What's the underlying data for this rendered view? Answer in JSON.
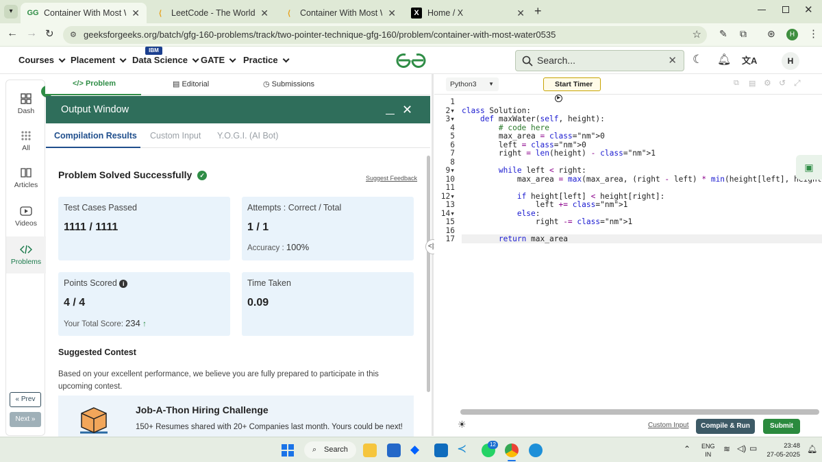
{
  "browser": {
    "tabs": [
      {
        "title": "Container With Most Water | Pr",
        "favicon": "GG",
        "active": true
      },
      {
        "title": "LeetCode - The World's Leading",
        "favicon": "leetcode-icon",
        "active": false
      },
      {
        "title": "Container With Most Water - Le",
        "favicon": "leetcode-icon",
        "active": false
      },
      {
        "title": "Home / X",
        "favicon": "X",
        "active": false
      }
    ],
    "url": "geeksforgeeks.org/batch/gfg-160-problems/track/two-pointer-technique-gfg-160/problem/container-with-most-water0535",
    "profile_initial": "H"
  },
  "header": {
    "nav": [
      {
        "label": "Courses"
      },
      {
        "label": "Placement"
      },
      {
        "label": "Data Science",
        "badge": "IBM"
      },
      {
        "label": "GATE"
      },
      {
        "label": "Practice"
      }
    ],
    "search_placeholder": "Search...",
    "avatar_initial": "H"
  },
  "left_rail": {
    "items": [
      {
        "label": "Dash",
        "icon": "dashboard-icon"
      },
      {
        "label": "All",
        "icon": "grid-icon"
      },
      {
        "label": "Articles",
        "icon": "book-icon"
      },
      {
        "label": "Videos",
        "icon": "video-icon"
      },
      {
        "label": "Problems",
        "icon": "code-icon",
        "active": true
      }
    ],
    "prev_label": "Prev",
    "next_label": "Next"
  },
  "problem_tabs": {
    "problem": "Problem",
    "editorial": "Editorial",
    "submissions": "Submissions"
  },
  "output": {
    "title": "Output Window",
    "tabs": {
      "compilation": "Compilation Results",
      "custom": "Custom Input",
      "yogi": "Y.O.G.I. (AI Bot)"
    },
    "status": "Problem Solved Successfully",
    "feedback": "Suggest Feedback",
    "cards": {
      "test_label": "Test Cases Passed",
      "test_value": "1111 / 1111",
      "attempts_label": "Attempts : Correct / Total",
      "attempts_value": "1 / 1",
      "accuracy_label": "Accuracy :",
      "accuracy_value": "100%",
      "points_label": "Points Scored",
      "points_value": "4 / 4",
      "total_label": "Your Total Score:",
      "total_value": "234",
      "time_label": "Time Taken",
      "time_value": "0.09"
    },
    "suggested_title": "Suggested Contest",
    "suggested_text": "Based on your excellent performance, we believe you are fully prepared to participate in this upcoming contest.",
    "contest_title": "Job-A-Thon Hiring Challenge",
    "contest_desc": "150+ Resumes shared with 20+ Companies last month. Yours could be next!"
  },
  "editor": {
    "language": "Python3",
    "timer_label": "Start Timer",
    "code_lines": [
      "",
      "class Solution:",
      "    def maxWater(self, height):",
      "        # code here",
      "        max_area = 0",
      "        left = 0",
      "        right = len(height) - 1",
      "",
      "        while left < right:",
      "            max_area = max(max_area, (right - left) * min(height[left], height[rig",
      "",
      "            if height[left] < height[right]:",
      "                left += 1",
      "            else:",
      "                right -= 1",
      "",
      "        return max_area"
    ],
    "custom_input": "Custom Input",
    "compile_label": "Compile & Run",
    "submit_label": "Submit"
  },
  "taskbar": {
    "search_label": "Search",
    "badge_count": "12",
    "lang_top": "ENG",
    "lang_bottom": "IN",
    "time": "23:48",
    "date": "27-05-2025"
  },
  "colors": {
    "gfg_green": "#2f8d46",
    "output_header": "#2f6e5b",
    "card_bg": "#e9f3fb",
    "submit": "#2b8a3e",
    "compile": "#3d5a66"
  }
}
